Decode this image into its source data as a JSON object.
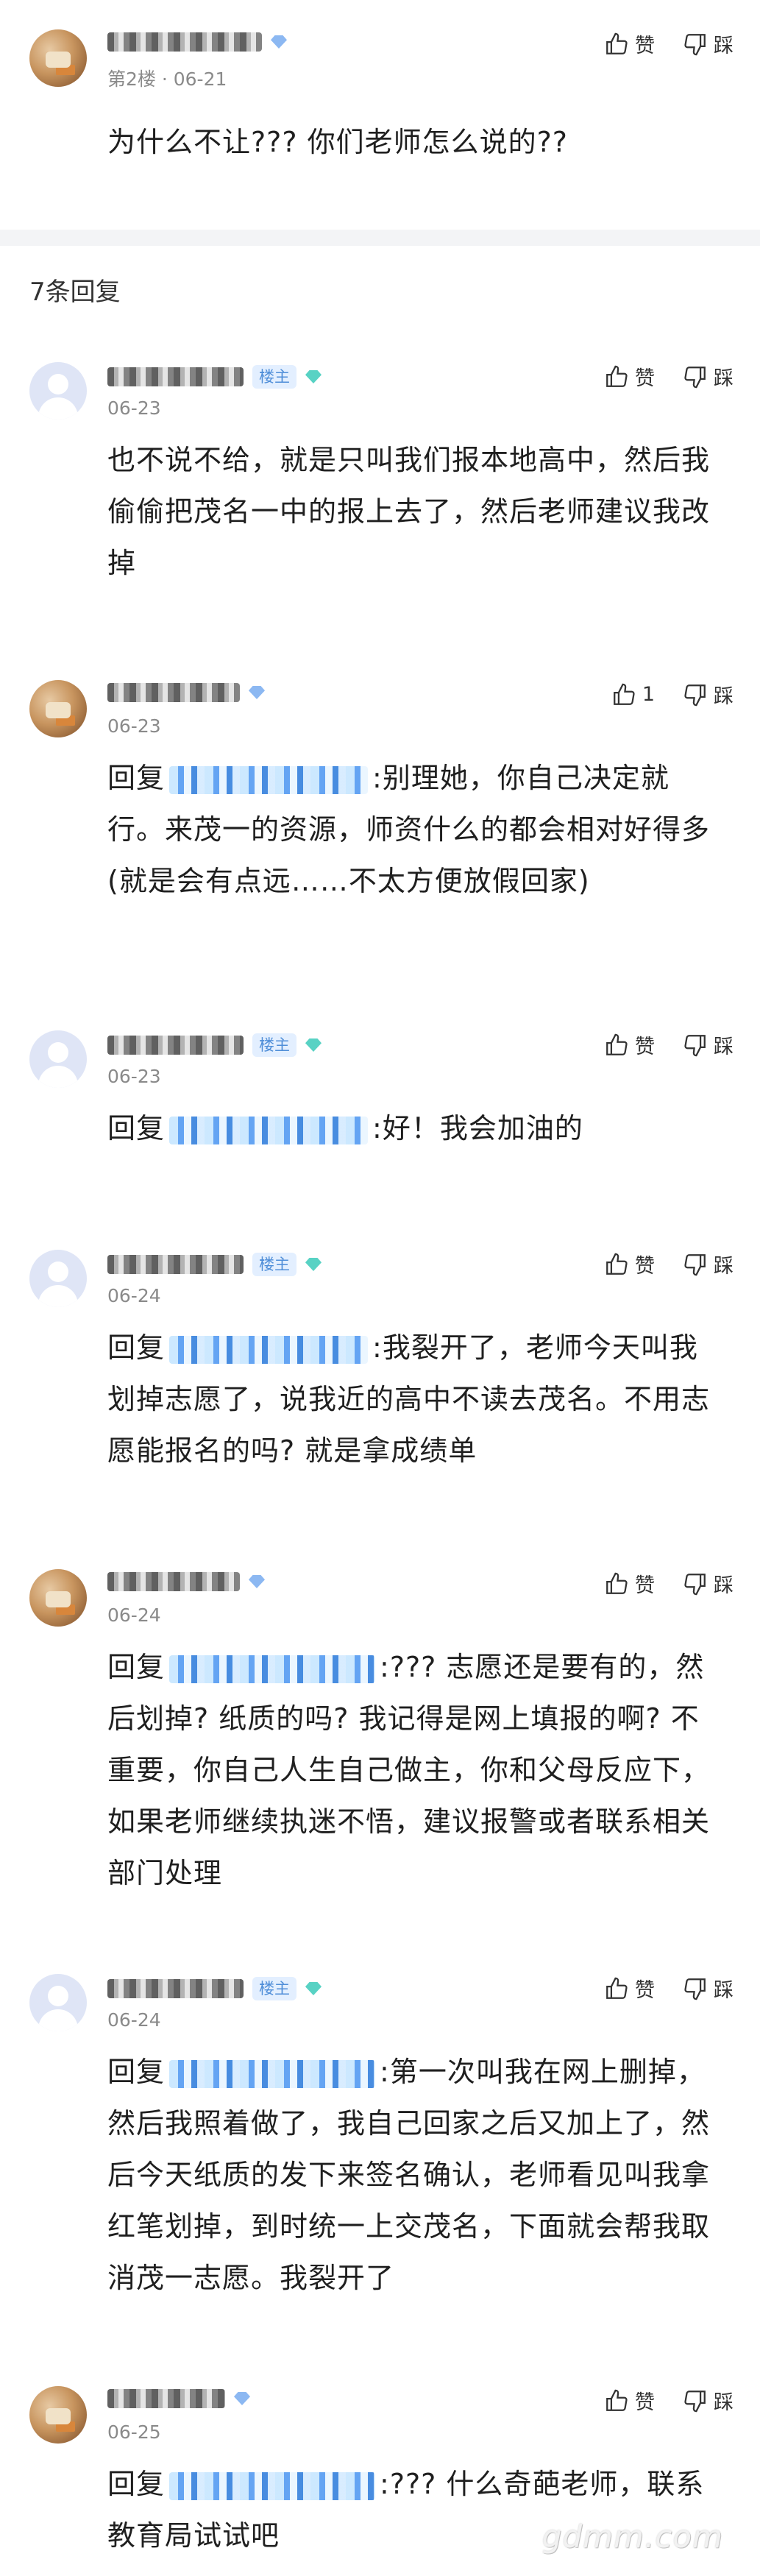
{
  "post": {
    "floor_date": "第2楼 · 06-21",
    "content": "为什么不让??? 你们老师怎么说的??",
    "like_label": "赞",
    "dislike_label": "踩"
  },
  "reply_count": "7条回复",
  "owner_tag": "楼主",
  "reply_prefix": "回复",
  "replies": [
    {
      "date": "06-23",
      "like": "赞",
      "dislike": "踩",
      "content": "也不说不给，就是只叫我们报本地高中，然后我偷偷把茂名一中的报上去了，然后老师建议我改掉"
    },
    {
      "date": "06-23",
      "like": "1",
      "dislike": "踩",
      "content": ":别理她，你自己决定就行。来茂一的资源，师资什么的都会相对好得多 (就是会有点远……不太方便放假回家)"
    },
    {
      "date": "06-23",
      "like": "赞",
      "dislike": "踩",
      "content": ":好！我会加油的"
    },
    {
      "date": "06-24",
      "like": "赞",
      "dislike": "踩",
      "content": ":我裂开了，老师今天叫我划掉志愿了，说我近的高中不读去茂名。不用志愿能报名的吗? 就是拿成绩单"
    },
    {
      "date": "06-24",
      "like": "赞",
      "dislike": "踩",
      "content": ":??? 志愿还是要有的，然后划掉? 纸质的吗? 我记得是网上填报的啊? 不重要，你自己人生自己做主，你和父母反应下，如果老师继续执迷不悟，建议报警或者联系相关部门处理"
    },
    {
      "date": "06-24",
      "like": "赞",
      "dislike": "踩",
      "content": ":第一次叫我在网上删掉，然后我照着做了，我自己回家之后又加上了，然后今天纸质的发下来签名确认，老师看见叫我拿红笔划掉，到时统一上交茂名，下面就会帮我取消茂一志愿。我裂开了"
    },
    {
      "date": "06-25",
      "like": "赞",
      "dislike": "踩",
      "content": ":??? 什么奇葩老师，联系教育局试试吧"
    }
  ],
  "watermark": "gdmm.com",
  "colors": {
    "owner_tag_text": "#4f8ed8",
    "owner_tag_bg": "#e3efff",
    "meta_gray": "#8a8a8a",
    "divider": "#f3f4f6"
  }
}
